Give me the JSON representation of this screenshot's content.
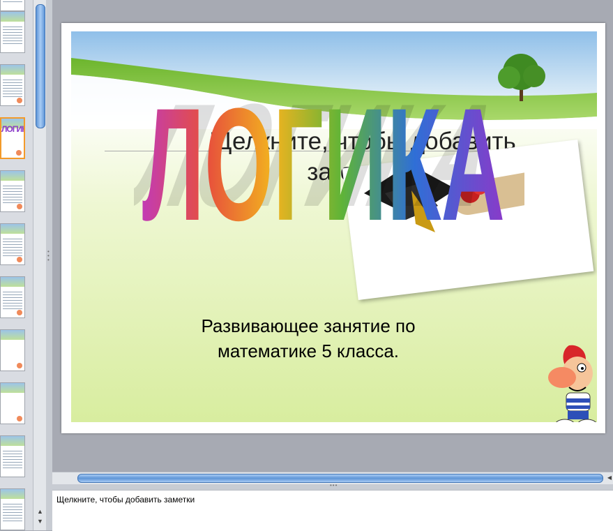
{
  "slide": {
    "logo_text": "ЛОГИКА",
    "title_placeholder": "Щелкните, чтобы добавить заголовок",
    "subtitle_line1": "Развивающее занятие по",
    "subtitle_line2": "математике 5 класса."
  },
  "notes": {
    "placeholder": "Щелкните, чтобы добавить заметки"
  },
  "thumbnails": {
    "active_logo": "ЛОГИКА",
    "active_index": 3
  },
  "colors": {
    "active_thumb_border": "#f39a2a",
    "scrollbar": "#5f95d7",
    "logo_letters": [
      "#c23bb4",
      "#e7503c",
      "#f2b31f",
      "#5fb437",
      "#2f6fd6",
      "#8a3ac9"
    ]
  },
  "icons": [
    "scroll-up-arrow-icon",
    "scroll-down-arrow-icon",
    "scroll-right-arrow-icon",
    "grip-dots-icon"
  ]
}
